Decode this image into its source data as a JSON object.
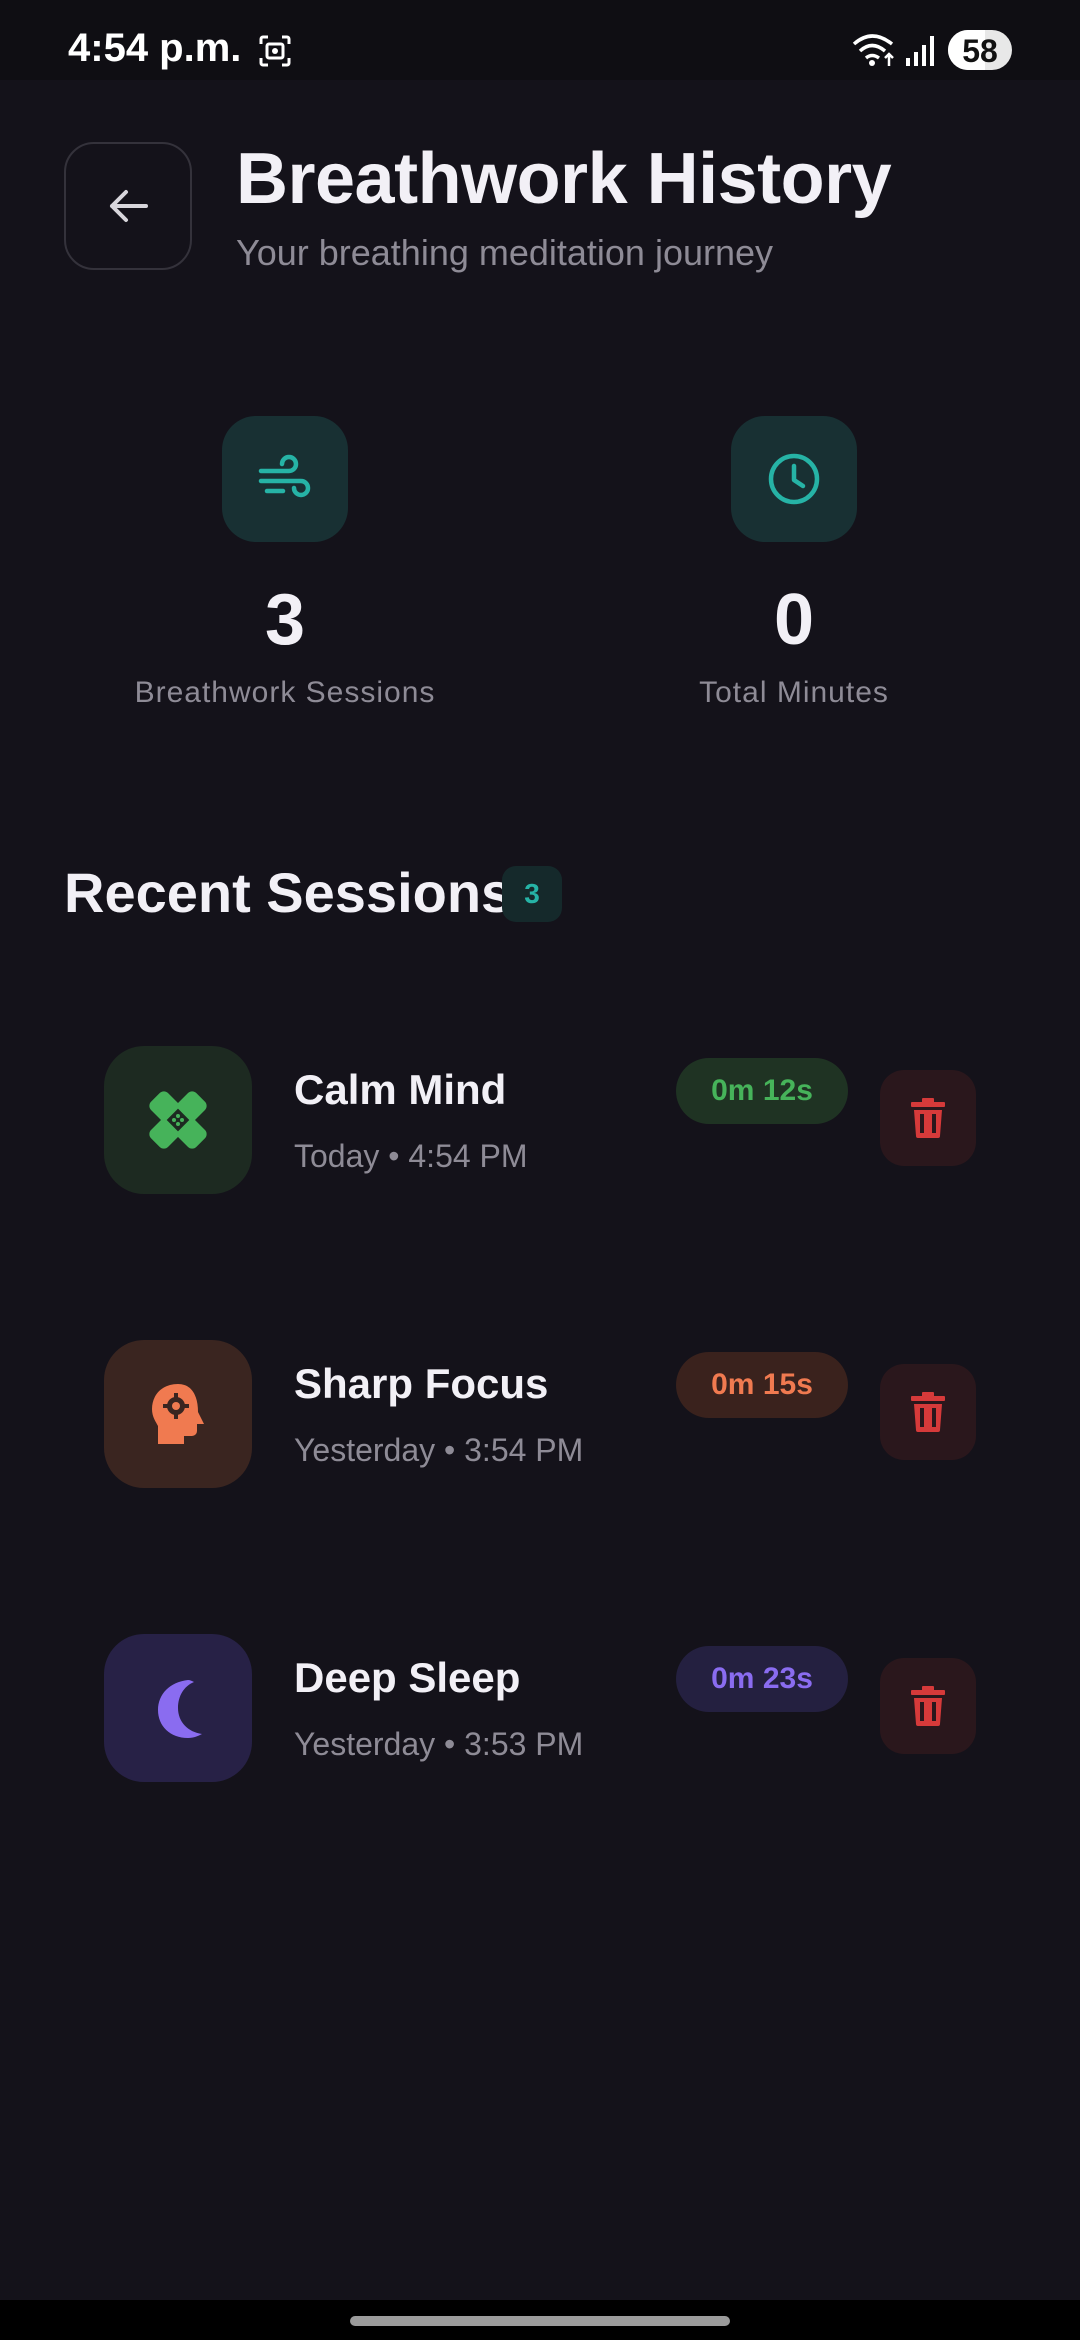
{
  "status_bar": {
    "time": "4:54 p.m.",
    "battery": "58",
    "battery_level": 0.58
  },
  "header": {
    "title": "Breathwork History",
    "subtitle": "Your breathing meditation journey"
  },
  "stats": {
    "sessions": {
      "value": "3",
      "label": "Breathwork Sessions",
      "icon": "wind-icon"
    },
    "minutes": {
      "value": "0",
      "label": "Total Minutes",
      "icon": "clock-icon"
    }
  },
  "recent": {
    "title": "Recent Sessions",
    "count": "3",
    "sessions": [
      {
        "name": "Calm Mind",
        "time": "Today • 4:54 PM",
        "duration": "0m 12s",
        "icon": "bandage-icon",
        "accent": "#46b35a",
        "icon_bg": "#1d2a21",
        "badge_bg": "#1f3323"
      },
      {
        "name": "Sharp Focus",
        "time": "Yesterday • 3:54 PM",
        "duration": "0m 15s",
        "icon": "head-gear-icon",
        "accent": "#f07a50",
        "icon_bg": "#3a2520",
        "badge_bg": "#3a221d"
      },
      {
        "name": "Deep Sleep",
        "time": "Yesterday • 3:53 PM",
        "duration": "0m 23s",
        "icon": "moon-icon",
        "accent": "#8a6cf0",
        "icon_bg": "#272146",
        "badge_bg": "#242040"
      }
    ]
  },
  "colors": {
    "background": "#14121a",
    "teal": "#26b3a6",
    "delete": "#d63a3a"
  }
}
